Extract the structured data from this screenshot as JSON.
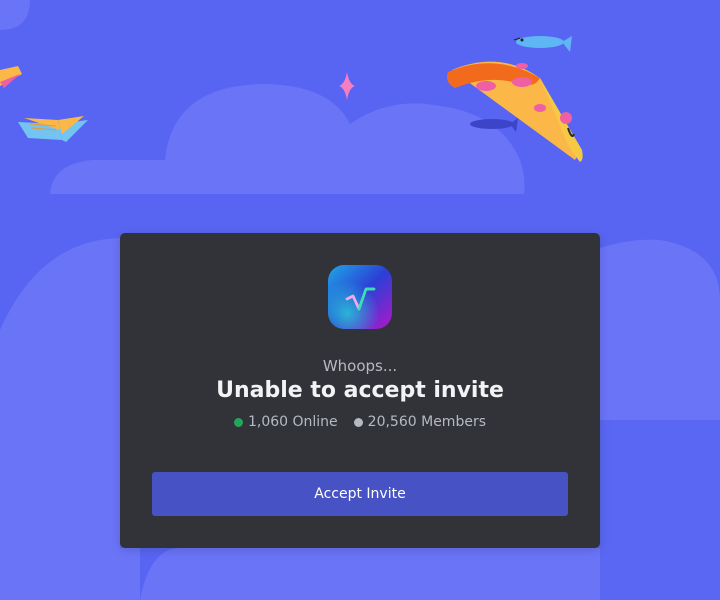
{
  "invite": {
    "subtitle": "Whoops...",
    "title": "Unable to accept invite",
    "online_count": "1,060 Online",
    "member_count": "20,560 Members",
    "accept_label": "Accept Invite"
  },
  "guild": {
    "icon": "sqrt-glyph-icon"
  },
  "colors": {
    "background": "#5865f2",
    "card": "#313338",
    "button": "#4752c4",
    "online_dot": "#23a55a",
    "members_dot": "#b5bac1"
  }
}
